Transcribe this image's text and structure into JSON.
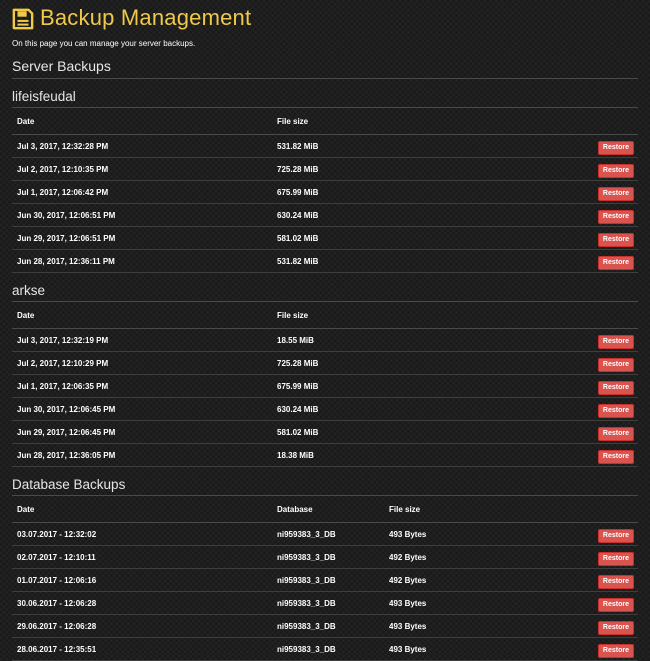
{
  "header": {
    "title": "Backup Management",
    "intro": "On this page you can manage your server backups.",
    "accent_color": "#f0c94a",
    "icon": "save-icon"
  },
  "server_backups": {
    "title": "Server Backups",
    "columns": [
      "Date",
      "File size"
    ],
    "restore_label": "Restore",
    "restore_color": "#d9534f",
    "servers": [
      {
        "name": "lifeisfeudal",
        "rows": [
          {
            "date": "Jul 3, 2017, 12:32:28 PM",
            "size": "531.82 MiB"
          },
          {
            "date": "Jul 2, 2017, 12:10:35 PM",
            "size": "725.28 MiB"
          },
          {
            "date": "Jul 1, 2017, 12:06:42 PM",
            "size": "675.99 MiB"
          },
          {
            "date": "Jun 30, 2017, 12:06:51 PM",
            "size": "630.24 MiB"
          },
          {
            "date": "Jun 29, 2017, 12:06:51 PM",
            "size": "581.02 MiB"
          },
          {
            "date": "Jun 28, 2017, 12:36:11 PM",
            "size": "531.82 MiB"
          }
        ]
      },
      {
        "name": "arkse",
        "rows": [
          {
            "date": "Jul 3, 2017, 12:32:19 PM",
            "size": "18.55 MiB"
          },
          {
            "date": "Jul 2, 2017, 12:10:29 PM",
            "size": "725.28 MiB"
          },
          {
            "date": "Jul 1, 2017, 12:06:35 PM",
            "size": "675.99 MiB"
          },
          {
            "date": "Jun 30, 2017, 12:06:45 PM",
            "size": "630.24 MiB"
          },
          {
            "date": "Jun 29, 2017, 12:06:45 PM",
            "size": "581.02 MiB"
          },
          {
            "date": "Jun 28, 2017, 12:36:05 PM",
            "size": "18.38 MiB"
          }
        ]
      }
    ]
  },
  "database_backups": {
    "title": "Database Backups",
    "columns": [
      "Date",
      "Database",
      "File size"
    ],
    "restore_label": "Restore",
    "rows": [
      {
        "date": "03.07.2017 - 12:32:02",
        "database": "ni959383_3_DB",
        "size": "493 Bytes"
      },
      {
        "date": "02.07.2017 - 12:10:11",
        "database": "ni959383_3_DB",
        "size": "492 Bytes"
      },
      {
        "date": "01.07.2017 - 12:06:16",
        "database": "ni959383_3_DB",
        "size": "492 Bytes"
      },
      {
        "date": "30.06.2017 - 12:06:28",
        "database": "ni959383_3_DB",
        "size": "493 Bytes"
      },
      {
        "date": "29.06.2017 - 12:06:28",
        "database": "ni959383_3_DB",
        "size": "493 Bytes"
      },
      {
        "date": "28.06.2017 - 12:35:51",
        "database": "ni959383_3_DB",
        "size": "493 Bytes"
      }
    ]
  }
}
